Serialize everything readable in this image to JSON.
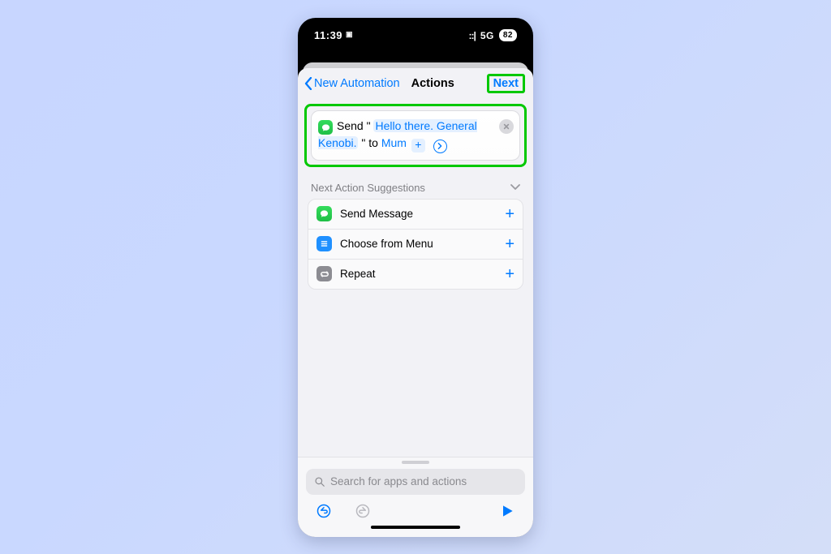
{
  "statusbar": {
    "time": "11:39",
    "network": "5G",
    "battery": "82"
  },
  "nav": {
    "back": "New Automation",
    "title": "Actions",
    "next": "Next"
  },
  "action": {
    "prefix": "Send \"",
    "message": "Hello there. General Kenobi.",
    "middle": "\" to",
    "recipient": "Mum"
  },
  "suggestions": {
    "header": "Next Action Suggestions",
    "items": [
      {
        "label": "Send Message"
      },
      {
        "label": "Choose from Menu"
      },
      {
        "label": "Repeat"
      }
    ]
  },
  "search": {
    "placeholder": "Search for apps and actions"
  }
}
